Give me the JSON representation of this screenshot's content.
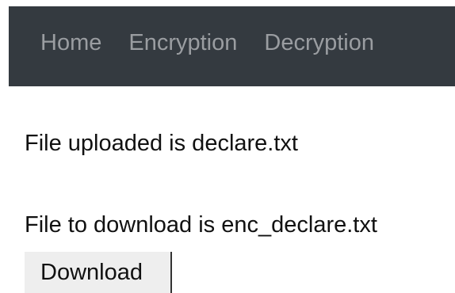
{
  "nav": {
    "items": [
      {
        "label": "Home"
      },
      {
        "label": "Encryption"
      },
      {
        "label": "Decryption"
      }
    ]
  },
  "main": {
    "uploaded_message": "File uploaded is declare.txt",
    "download_message": "File to download is enc_declare.txt",
    "download_button": "Download"
  },
  "colors": {
    "navbar_bg": "#343a40",
    "nav_text": "#9a9da1",
    "button_bg": "#eeeeee"
  }
}
